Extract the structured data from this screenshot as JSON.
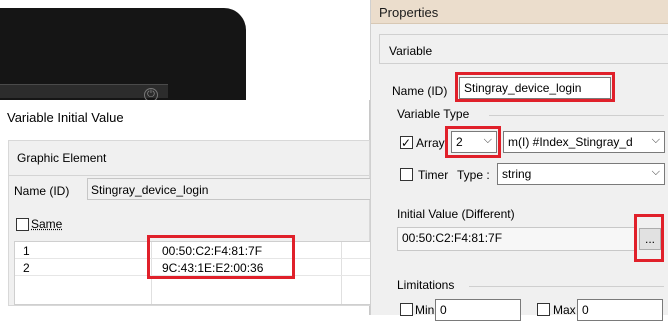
{
  "device_preview": {
    "power_icon": "power-icon"
  },
  "initial_value_dialog": {
    "title": "Variable Initial Value",
    "group_title": "Graphic Element",
    "name_label": "Name (ID)",
    "name_value": "Stingray_device_login",
    "same_label": "Same",
    "same_checked": false,
    "rows": [
      {
        "index": "1",
        "value": "00:50:C2:F4:81:7F"
      },
      {
        "index": "2",
        "value": "9C:43:1E:E2:00:36"
      }
    ]
  },
  "properties": {
    "title": "Properties",
    "section": "Variable",
    "name_label": "Name (ID)",
    "name_value": "Stingray_device_login",
    "variable_type_label": "Variable Type",
    "array_label": "Array",
    "array_checked": true,
    "array_count": "2",
    "array_index_value": "m(I) #Index_Stingray_d",
    "timer_label": "Timer",
    "timer_checked": false,
    "type_label": "Type :",
    "type_value": "string",
    "initial_value_label": "Initial Value (Different)",
    "initial_value": "00:50:C2:F4:81:7F",
    "browse_label": "...",
    "limitations_label": "Limitations",
    "min_label": "Min",
    "min_value": "0",
    "max_label": "Max",
    "max_value": "0"
  },
  "colors": {
    "highlight": "#e0202a",
    "title_bar": "#ebddcc"
  }
}
